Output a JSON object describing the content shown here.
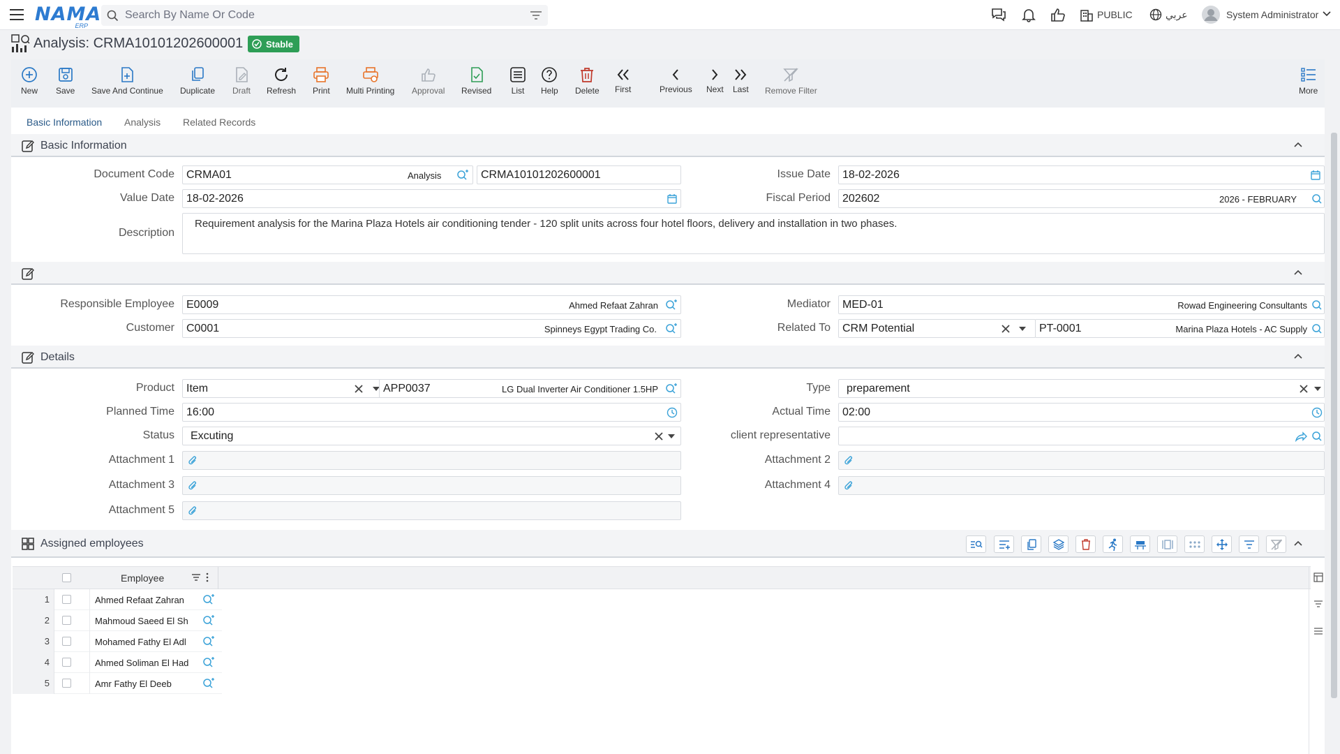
{
  "app": {
    "search_placeholder": "Search By Name Or Code",
    "public_label": "PUBLIC",
    "language_label": "عربي",
    "user_name": "System Administrator",
    "logo_text": "NAMA",
    "logo_sub": "ERP"
  },
  "page": {
    "title": "Analysis: CRMA10101202600001",
    "status": "Stable"
  },
  "toolbar": {
    "new": "New",
    "save": "Save",
    "save_continue": "Save And Continue",
    "duplicate": "Duplicate",
    "draft": "Draft",
    "refresh": "Refresh",
    "print": "Print",
    "multi_printing": "Multi Printing",
    "approval": "Approval",
    "revised": "Revised",
    "list": "List",
    "help": "Help",
    "delete": "Delete",
    "first": "First",
    "previous": "Previous",
    "next": "Next",
    "last": "Last",
    "remove_filter": "Remove Filter",
    "more": "More"
  },
  "tabs": [
    "Basic Information",
    "Analysis",
    "Related Records"
  ],
  "sections": {
    "basic": "Basic Information",
    "details": "Details",
    "assigned": "Assigned employees"
  },
  "form": {
    "document_code": {
      "label": "Document Code",
      "code": "CRMA01",
      "type": "Analysis",
      "number": "CRMA10101202600001"
    },
    "issue_date": {
      "label": "Issue Date",
      "value": "18-02-2026"
    },
    "value_date": {
      "label": "Value Date",
      "value": "18-02-2026"
    },
    "fiscal_period": {
      "label": "Fiscal Period",
      "value": "202602",
      "name": "2026 - FEBRUARY"
    },
    "description": {
      "label": "Description",
      "value": "Requirement analysis for the Marina Plaza Hotels air conditioning tender - 120 split units across four hotel floors, delivery and installation in two phases."
    },
    "responsible_employee": {
      "label": "Responsible Employee",
      "code": "E0009",
      "name": "Ahmed Refaat Zahran"
    },
    "mediator": {
      "label": "Mediator",
      "code": "MED-01",
      "name": "Rowad Engineering Consultants"
    },
    "customer": {
      "label": "Customer",
      "code": "C0001",
      "name": "Spinneys Egypt Trading Co."
    },
    "related_to": {
      "label": "Related To",
      "type": "CRM Potential",
      "code": "PT-0001",
      "name": "Marina Plaza Hotels - AC Supply"
    },
    "product": {
      "label": "Product",
      "type": "Item",
      "code": "APP0037",
      "name": "LG Dual Inverter Air Conditioner 1.5HP"
    },
    "type": {
      "label": "Type",
      "value": "preparement"
    },
    "planned_time": {
      "label": "Planned Time",
      "value": "16:00"
    },
    "actual_time": {
      "label": "Actual Time",
      "value": "02:00"
    },
    "status": {
      "label": "Status",
      "value": "Excuting"
    },
    "client_rep": {
      "label": "client representative",
      "value": ""
    },
    "attachment1": {
      "label": "Attachment 1"
    },
    "attachment2": {
      "label": "Attachment 2"
    },
    "attachment3": {
      "label": "Attachment 3"
    },
    "attachment4": {
      "label": "Attachment 4"
    },
    "attachment5": {
      "label": "Attachment 5"
    }
  },
  "grid": {
    "column": "Employee",
    "rows": [
      {
        "num": "1",
        "name": "Ahmed Refaat Zahran"
      },
      {
        "num": "2",
        "name": "Mahmoud Saeed El Sh"
      },
      {
        "num": "3",
        "name": "Mohamed Fathy El Adl"
      },
      {
        "num": "4",
        "name": "Ahmed Soliman El Had"
      },
      {
        "num": "5",
        "name": "Amr Fathy El Deeb"
      }
    ]
  },
  "colors": {
    "brand": "#2d7bd1",
    "status_green": "#2e9e56",
    "accent_blue": "#2a79c6",
    "icon_cyan": "#3aa2d8",
    "delete_red": "#c0392b",
    "print_orange": "#e8742a"
  }
}
